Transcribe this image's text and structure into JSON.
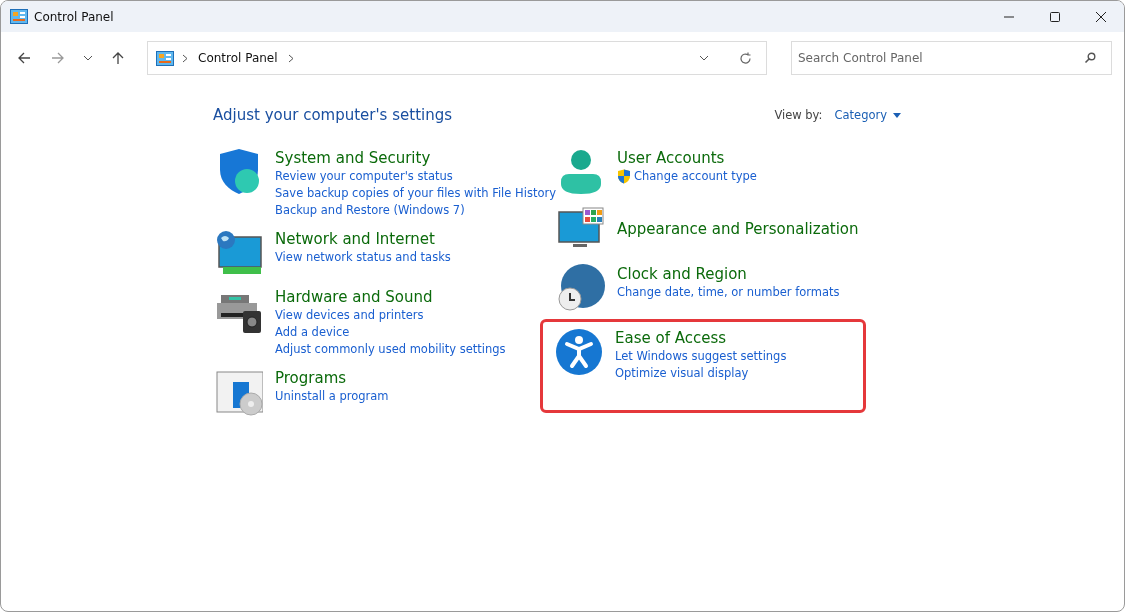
{
  "window": {
    "title": "Control Panel"
  },
  "address_bar": {
    "breadcrumb": [
      "Control Panel"
    ]
  },
  "search": {
    "placeholder": "Search Control Panel"
  },
  "heading": "Adjust your computer's settings",
  "view_by": {
    "label": "View by:",
    "value": "Category"
  },
  "columns": [
    {
      "categories": [
        {
          "kind": "security",
          "title": "System and Security",
          "highlighted": false,
          "links": [
            {
              "text": "Review your computer's status",
              "shield": false
            },
            {
              "text": "Save backup copies of your files with File History",
              "shield": false
            },
            {
              "text": "Backup and Restore (Windows 7)",
              "shield": false
            }
          ]
        },
        {
          "kind": "network",
          "title": "Network and Internet",
          "highlighted": false,
          "links": [
            {
              "text": "View network status and tasks",
              "shield": false
            }
          ]
        },
        {
          "kind": "hardware",
          "title": "Hardware and Sound",
          "highlighted": false,
          "links": [
            {
              "text": "View devices and printers",
              "shield": false
            },
            {
              "text": "Add a device",
              "shield": false
            },
            {
              "text": "Adjust commonly used mobility settings",
              "shield": false
            }
          ]
        },
        {
          "kind": "programs",
          "title": "Programs",
          "highlighted": false,
          "links": [
            {
              "text": "Uninstall a program",
              "shield": false
            }
          ]
        }
      ]
    },
    {
      "categories": [
        {
          "kind": "user",
          "title": "User Accounts",
          "highlighted": false,
          "links": [
            {
              "text": "Change account type",
              "shield": true
            }
          ]
        },
        {
          "kind": "appearance",
          "title": "Appearance and Personalization",
          "highlighted": false
        },
        {
          "kind": "clock",
          "title": "Clock and Region",
          "highlighted": false,
          "links": [
            {
              "text": "Change date, time, or number formats",
              "shield": false
            }
          ]
        },
        {
          "kind": "access",
          "title": "Ease of Access",
          "highlighted": true,
          "links": [
            {
              "text": "Let Windows suggest settings",
              "shield": false
            },
            {
              "text": "Optimize visual display",
              "shield": false
            }
          ]
        }
      ]
    }
  ]
}
